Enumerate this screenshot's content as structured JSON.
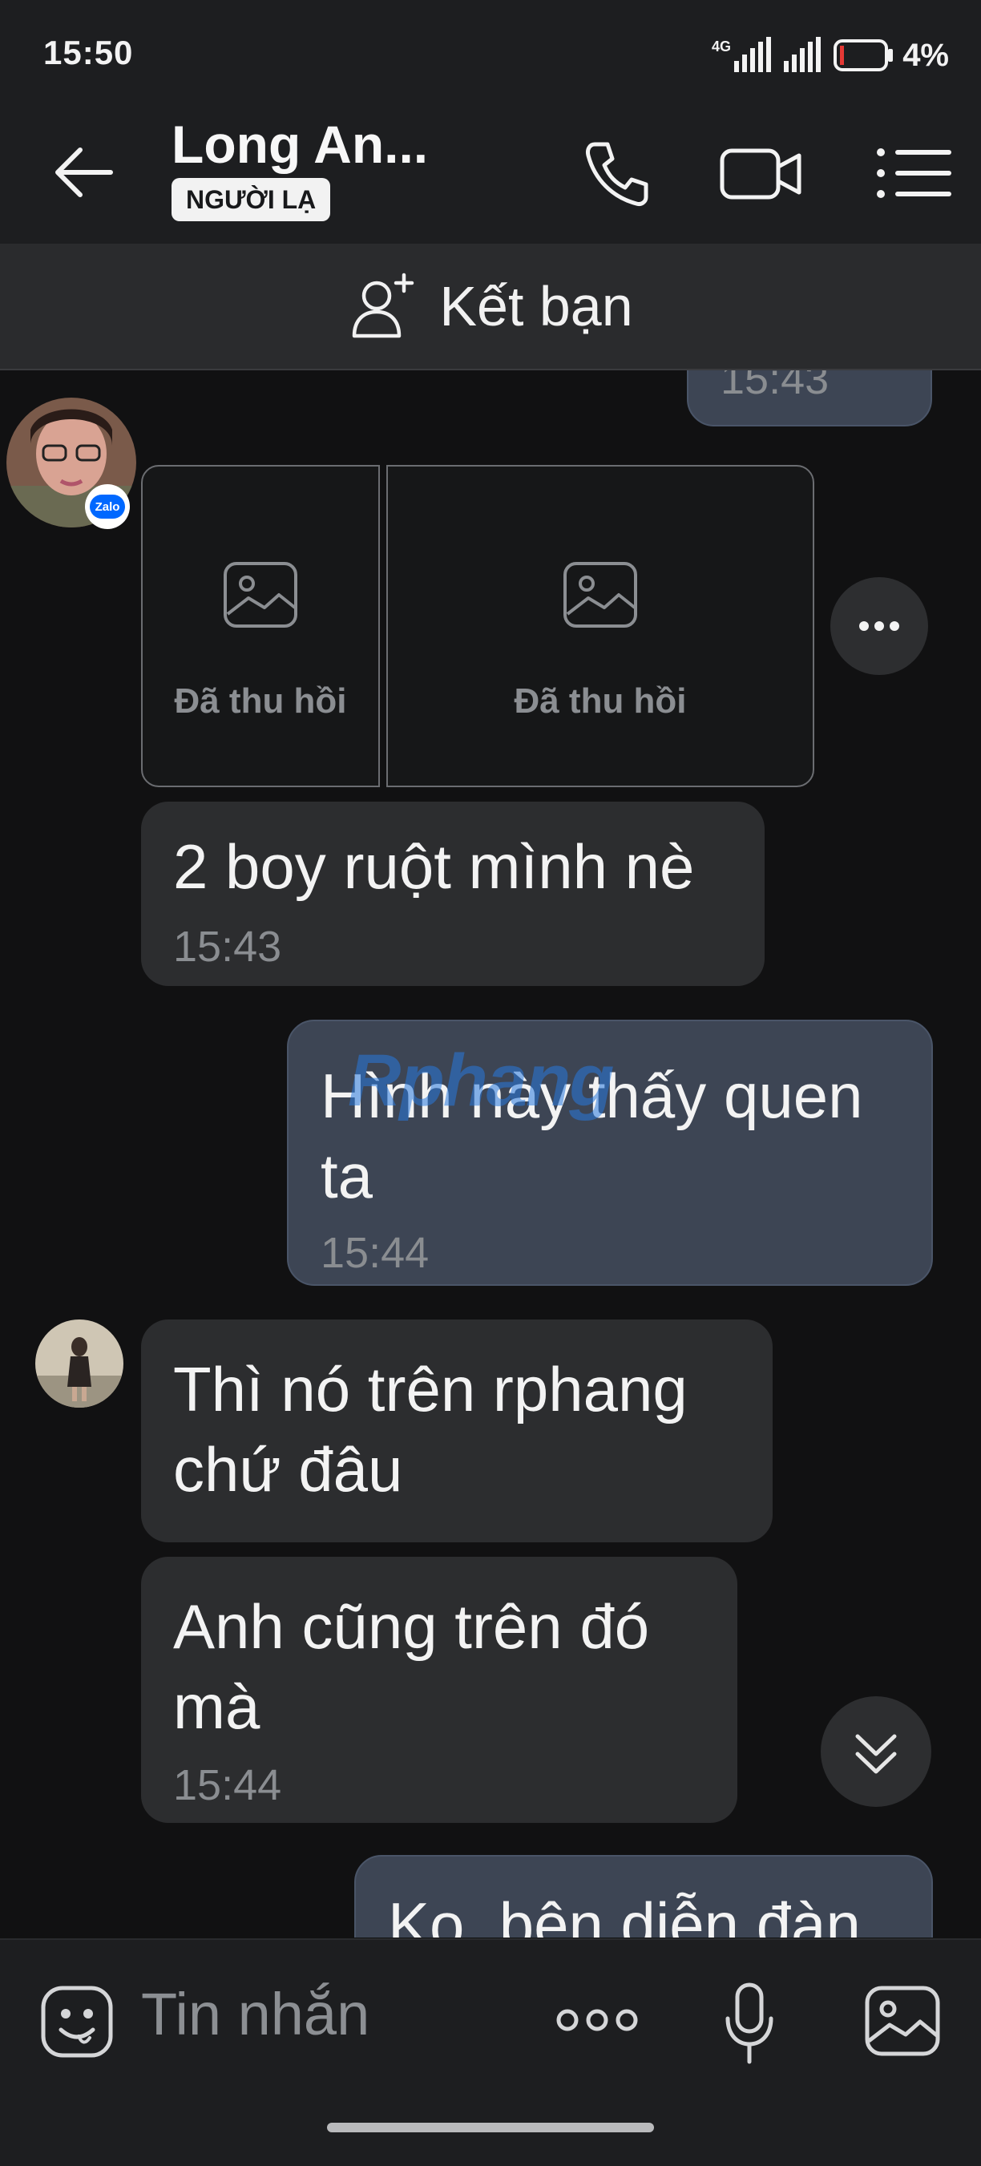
{
  "status_bar": {
    "time": "15:50",
    "network": "4G",
    "battery_percent": "4%",
    "battery_level": 0.04
  },
  "header": {
    "contact_name": "Long An...",
    "badge": "NGƯỜI LẠ",
    "icons": [
      "back-arrow-icon",
      "phone-icon",
      "video-camera-icon",
      "menu-list-icon"
    ]
  },
  "friend_bar": {
    "label": "Kết bạn"
  },
  "messages": {
    "top_partial_time": "15:43",
    "recalled_images": [
      "Đã thu hồi",
      "Đã thu hồi"
    ],
    "msg1_text": "2 boy ruột mình nè",
    "msg1_time": "15:43",
    "msg2_line1": "Hình này thấy quen",
    "msg2_line2": "ta",
    "msg2_time": "15:44",
    "watermark": "Rphang",
    "msg3_line1": "Thì nó trên rphang",
    "msg3_line2": "chứ đâu",
    "msg4_line1": "Anh cũng trên đó",
    "msg4_line2": "mà",
    "msg4_time": "15:44",
    "msg5_partial": "Ko, bên diễn đàn"
  },
  "input_bar": {
    "placeholder": "Tin nhắn"
  },
  "colors": {
    "background": "#111112",
    "header": "#1d1e20",
    "incoming_bubble": "#2c2d2f",
    "outgoing_bubble": "#3d4554",
    "zalo_blue": "#0068ff"
  }
}
